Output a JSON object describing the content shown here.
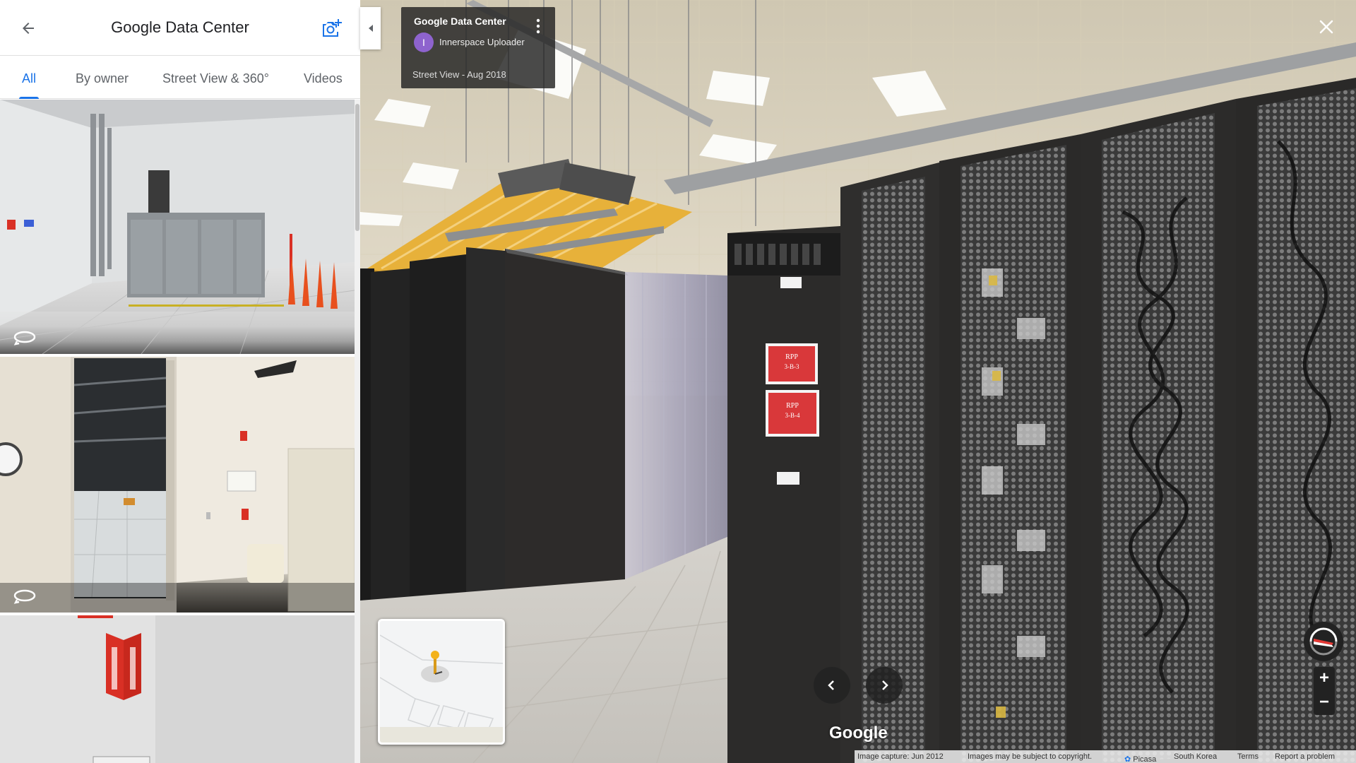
{
  "panel": {
    "title": "Google Data Center",
    "tabs": [
      {
        "label": "All",
        "active": true
      },
      {
        "label": "By owner",
        "active": false
      },
      {
        "label": "Street View & 360°",
        "active": false
      },
      {
        "label": "Videos",
        "active": false
      }
    ],
    "photos": [
      "360 photo",
      "360 photo",
      "photo"
    ]
  },
  "info_card": {
    "title": "Google Data Center",
    "uploader_initial": "I",
    "uploader_name": "Innerspace Uploader",
    "date": "Street View - Aug 2018"
  },
  "scene": {
    "labels": [
      {
        "line1": "RPP",
        "line2": "3-B-3"
      },
      {
        "line1": "RPP",
        "line2": "3-B-4"
      }
    ]
  },
  "branding": "Google",
  "footer": {
    "capture": "Image capture: Jun 2012",
    "copyright": "Images may be subject to copyright.",
    "source": "Picasa",
    "region": "South Korea",
    "terms": "Terms",
    "report": "Report a problem"
  },
  "icons": {
    "back": "arrow-back-icon",
    "add_photo": "add-photo-icon",
    "collapse": "collapse-left-icon",
    "menu": "more-vert-icon",
    "close": "close-icon",
    "pano": "360-icon",
    "compass": "compass-icon",
    "prev": "chevron-left-icon",
    "next": "chevron-right-icon"
  },
  "colors": {
    "accent": "#1a73e8",
    "avatar": "#8e63ce",
    "label_red": "#d9383a",
    "cable_tray": "#e8b43c"
  }
}
